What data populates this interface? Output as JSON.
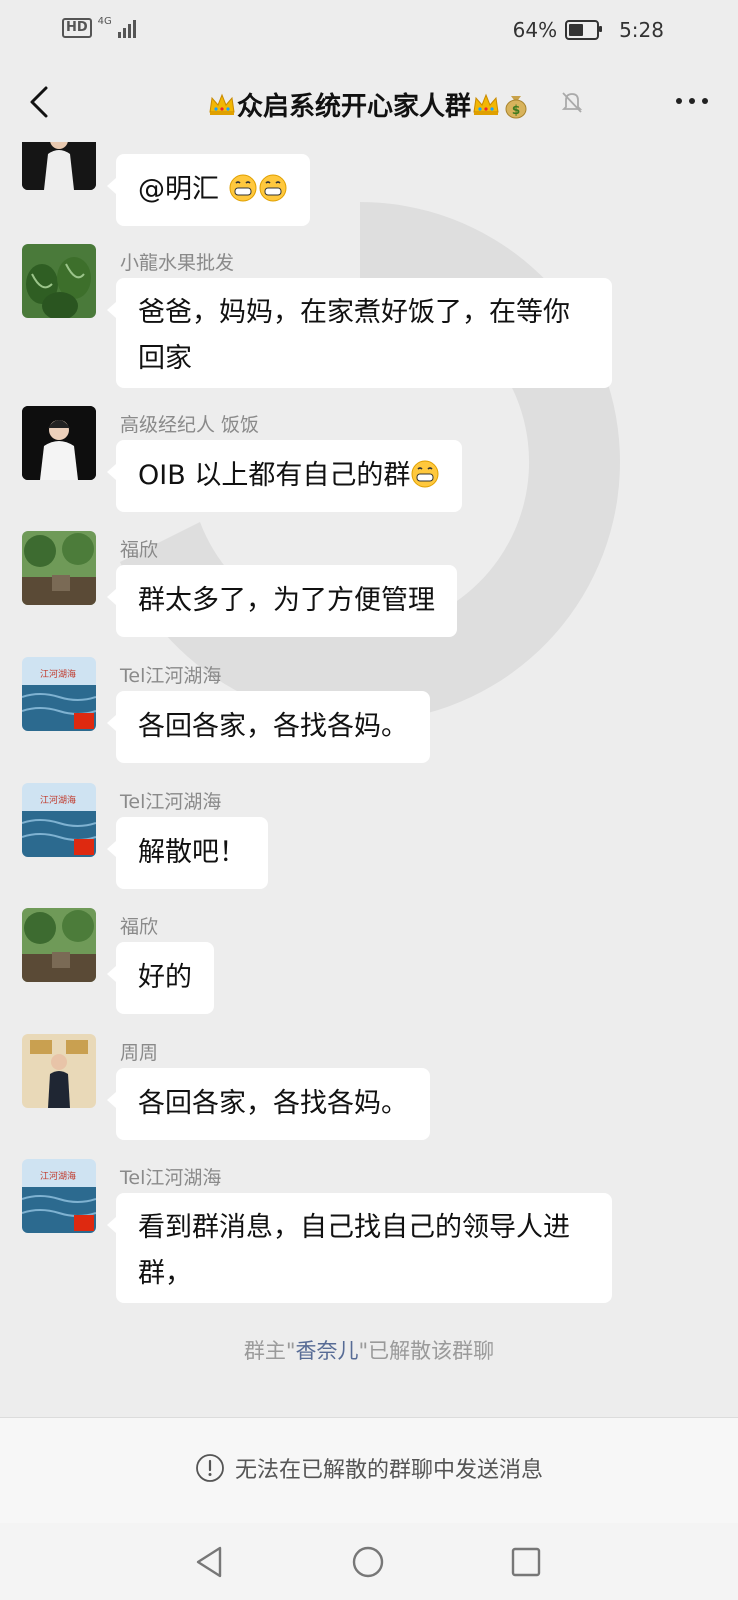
{
  "status_bar": {
    "hd_label": "HD",
    "network_label": "4G",
    "battery_percent": "64%",
    "battery_level": 0.64,
    "time": "5:28"
  },
  "header": {
    "title": "众启系统开心家人群",
    "title_prefix_icon": "crown-emoji",
    "title_suffix_icons": [
      "crown-emoji",
      "money-bag-emoji"
    ],
    "mute_icon": "bell-slash-icon",
    "more_icon": "more-dots-icon",
    "back_icon": "chevron-left-icon"
  },
  "messages": [
    {
      "sender": "",
      "text": "@明汇 ",
      "emoji": [
        "grin-emoji",
        "grin-emoji"
      ],
      "avatar": "woman-white-suit"
    },
    {
      "sender": "小龍水果批发",
      "text": "爸爸，妈妈，在家煮好饭了，在等你回家",
      "avatar": "watermelons"
    },
    {
      "sender": "高级经纪人 饭饭",
      "text": "OIB 以上都有自己的群",
      "emoji": [
        "grin-emoji"
      ],
      "avatar": "woman-white-suit"
    },
    {
      "sender": "福欣",
      "text": "群太多了，为了方便管理",
      "avatar": "garden"
    },
    {
      "sender": "Tel江河湖海",
      "text": "各回各家，各找各妈。",
      "avatar": "sea-flag"
    },
    {
      "sender": "Tel江河湖海",
      "text": "解散吧！",
      "avatar": "sea-flag"
    },
    {
      "sender": "福欣",
      "text": "好的",
      "avatar": "garden"
    },
    {
      "sender": "周周",
      "text": "各回各家，各找各妈。",
      "avatar": "man-suit"
    },
    {
      "sender": "Tel江河湖海",
      "text": "看到群消息，自己找自己的领导人进群，",
      "avatar": "sea-flag"
    }
  ],
  "avatar_caption": "江河湖海",
  "system_notice": {
    "prefix": "群主\"",
    "owner_name": "香奈儿",
    "suffix": "\"已解散该群聊"
  },
  "input_bar": {
    "icon": "exclamation-circle-icon",
    "text": "无法在已解散的群聊中发送消息"
  },
  "system_nav": {
    "back_icon": "triangle-back-icon",
    "home_icon": "circle-home-icon",
    "recents_icon": "square-recents-icon"
  }
}
